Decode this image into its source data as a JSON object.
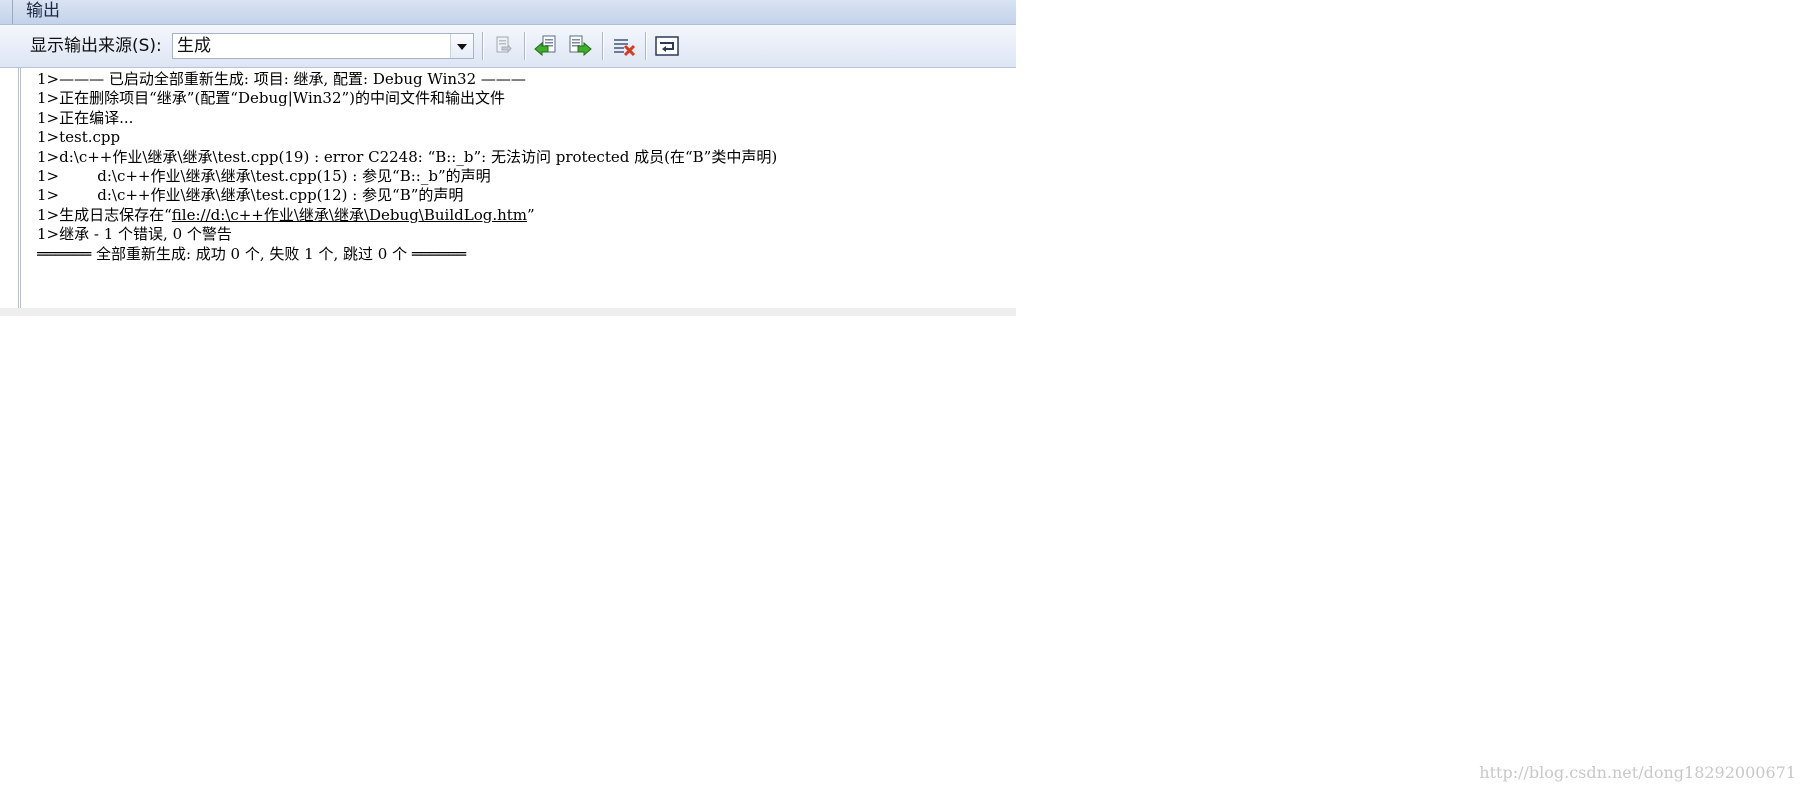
{
  "window": {
    "title": "输出"
  },
  "toolbar": {
    "source_label": "显示输出来源(S):",
    "source_value": "生成",
    "buttons": [
      {
        "icon": "goto-location-icon"
      },
      {
        "icon": "previous-message-icon"
      },
      {
        "icon": "next-message-icon"
      },
      {
        "icon": "clear-all-icon"
      },
      {
        "icon": "word-wrap-icon"
      }
    ]
  },
  "log": {
    "lines": [
      {
        "text": "1>——— 已启动全部重新生成: 项目: 继承, 配置: Debug Win32 ———"
      },
      {
        "text": "1>正在删除项目“继承”(配置“Debug|Win32”)的中间文件和输出文件"
      },
      {
        "text": "1>正在编译..."
      },
      {
        "text": "1>test.cpp"
      },
      {
        "text": "1>d:\\c++作业\\继承\\继承\\test.cpp(19) : error C2248: “B::_b”: 无法访问 protected 成员(在“B”类中声明)"
      },
      {
        "text": "1>        d:\\c++作业\\继承\\继承\\test.cpp(15) : 参见“B::_b”的声明"
      },
      {
        "text": "1>        d:\\c++作业\\继承\\继承\\test.cpp(12) : 参见“B”的声明"
      },
      {
        "prefix": "1>生成日志保存在“",
        "link": "file://d:\\c++作业\\继承\\继承\\Debug\\BuildLog.htm",
        "suffix": "”"
      },
      {
        "text": "1>继承 - 1 个错误, 0 个警告"
      },
      {
        "text": "══════ 全部重新生成: 成功 0 个, 失败 1 个, 跳过 0 个 ══════"
      }
    ]
  },
  "watermark": "http://blog.csdn.net/dong18292000671"
}
